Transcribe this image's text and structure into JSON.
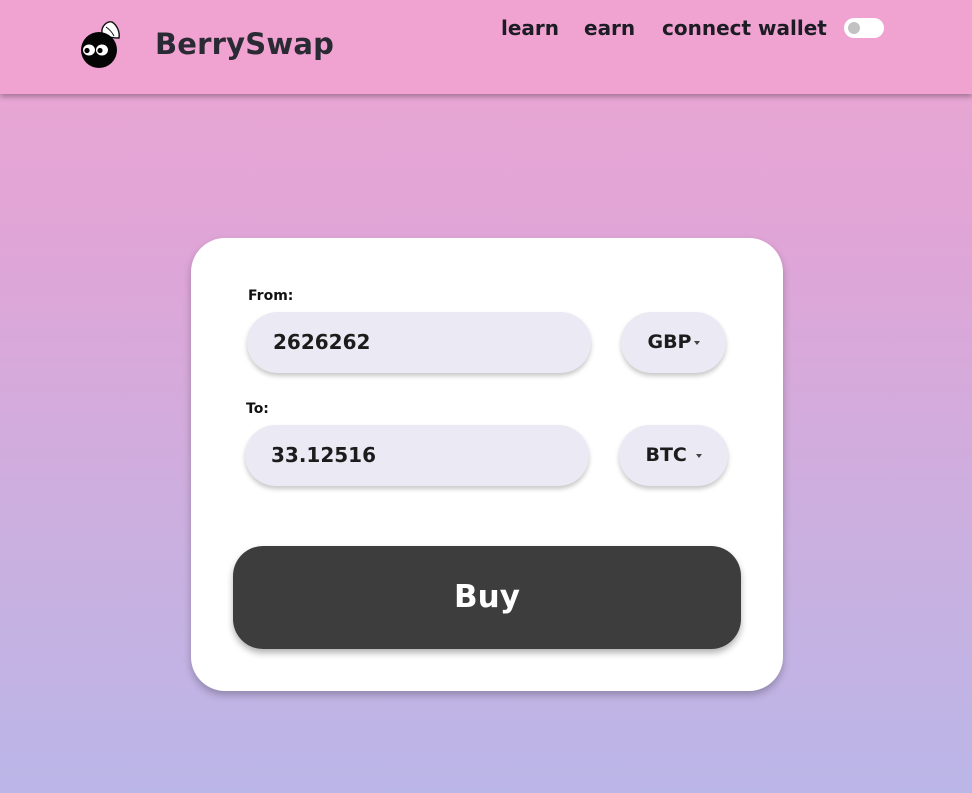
{
  "header": {
    "brand": "BerrySwap",
    "logo_icon": "berry-logo-icon",
    "nav": [
      {
        "label": "learn"
      },
      {
        "label": "earn"
      },
      {
        "label": "connect wallet"
      }
    ],
    "theme_toggle": {
      "state": "off"
    }
  },
  "swap": {
    "from": {
      "label": "From:",
      "amount": "2626262",
      "currency": "GBP"
    },
    "to": {
      "label": "To:",
      "amount": "33.12516",
      "currency": "BTC"
    },
    "buy_label": "Buy"
  },
  "colors": {
    "header_bg": "#f0a2d0",
    "background_top": "#eca6d2",
    "background_bottom": "#bbb6e8",
    "card_bg": "#ffffff",
    "input_bg": "#ebe9f3",
    "buy_button_bg": "#3d3d3d"
  }
}
